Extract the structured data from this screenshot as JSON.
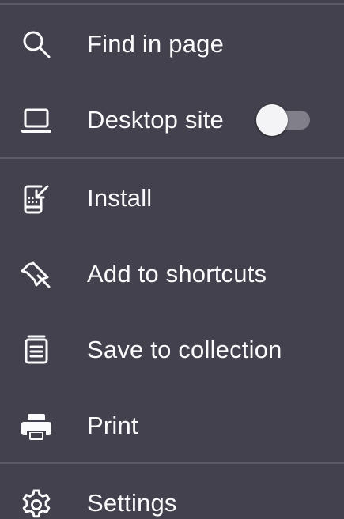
{
  "menu": {
    "items": [
      {
        "label": "Find in page",
        "icon": "search-icon"
      },
      {
        "label": "Desktop site",
        "icon": "laptop-icon",
        "toggle": {
          "state": "off"
        }
      },
      {
        "label": "Install",
        "icon": "install-app-icon"
      },
      {
        "label": "Add to shortcuts",
        "icon": "pin-icon"
      },
      {
        "label": "Save to collection",
        "icon": "collection-icon"
      },
      {
        "label": "Print",
        "icon": "printer-icon"
      },
      {
        "label": "Settings",
        "icon": "gear-icon"
      }
    ]
  },
  "colors": {
    "background": "#42414d",
    "text": "#fbfbfe",
    "divider": "#5b5a66",
    "toggle_track": "#807f8a",
    "toggle_thumb": "#f4f3f6"
  }
}
